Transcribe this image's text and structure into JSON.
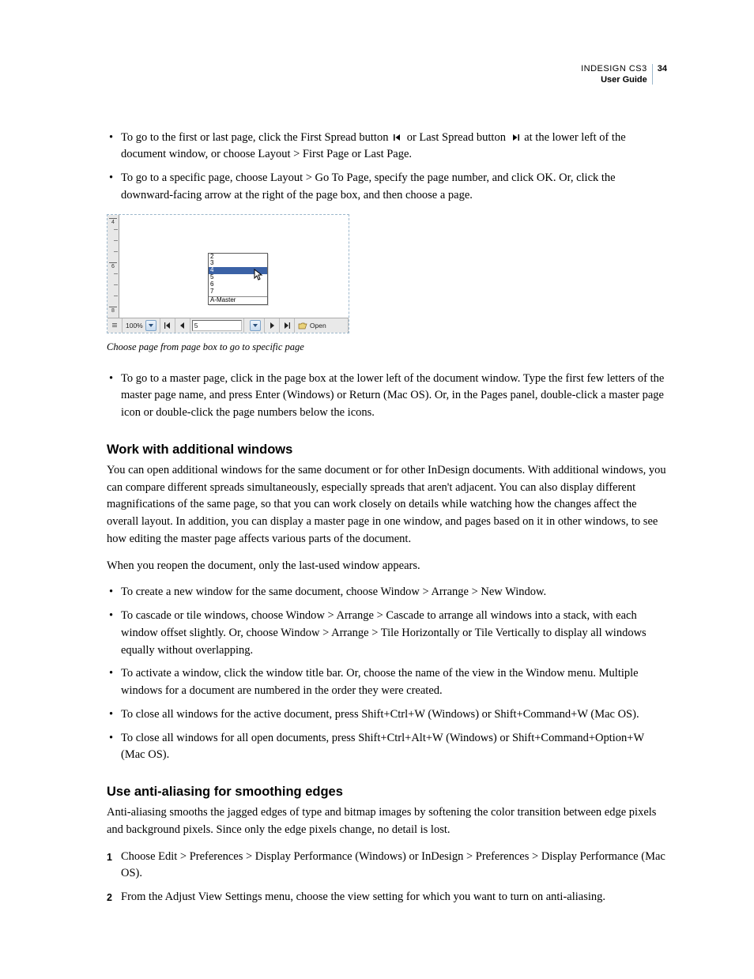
{
  "header": {
    "product": "INDESIGN CS3",
    "title": "User Guide",
    "page": "34"
  },
  "top_bullets": [
    "To go to the first or last page, click the First Spread button {ICON_FIRST} or Last Spread button {ICON_LAST} at the lower left of the document window, or choose Layout > First Page or Last Page.",
    "To go to a specific page, choose Layout > Go To Page, specify the page number, and click OK. Or, click the downward-facing arrow at the right of the page box, and then choose a page."
  ],
  "figure": {
    "ruler_labels": [
      "4",
      "6",
      "8"
    ],
    "dropdown_options": [
      "2",
      "3",
      "4",
      "5",
      "6",
      "7"
    ],
    "dropdown_selected_index": 2,
    "dropdown_master": "A-Master",
    "status": {
      "zoom": "100%",
      "pagebox_value": "5",
      "open_label": "Open"
    },
    "caption": "Choose page from page box to go to specific page"
  },
  "mid_bullets": [
    "To go to a master page, click in the page box at the lower left of the document window. Type the first few letters of the master page name, and press Enter (Windows) or Return (Mac OS). Or, in the Pages panel, double-click a master page icon or double-click the page numbers below the icons."
  ],
  "section1": {
    "heading": "Work with additional windows",
    "para1": "You can open additional windows for the same document or for other InDesign documents. With additional windows, you can compare different spreads simultaneously, especially spreads that aren't adjacent. You can also display different magnifications of the same page, so that you can work closely on details while watching how the changes affect the overall layout. In addition, you can display a master page in one window, and pages based on it in other windows, to see how editing the master page affects various parts of the document.",
    "para2": "When you reopen the document, only the last-used window appears.",
    "bullets": [
      "To create a new window for the same document, choose Window > Arrange > New Window.",
      "To cascade or tile windows, choose Window > Arrange > Cascade to arrange all windows into a stack, with each window offset slightly. Or, choose Window > Arrange > Tile Horizontally or Tile Vertically to display all windows equally without overlapping.",
      "To activate a window, click the window title bar. Or, choose the name of the view in the Window menu. Multiple windows for a document are numbered in the order they were created.",
      "To close all windows for the active document, press Shift+Ctrl+W (Windows) or Shift+Command+W (Mac OS).",
      "To close all windows for all open documents, press Shift+Ctrl+Alt+W (Windows) or Shift+Command+Option+W (Mac OS)."
    ]
  },
  "section2": {
    "heading": "Use anti-aliasing for smoothing edges",
    "para1": "Anti-aliasing smooths the jagged edges of type and bitmap images by softening the color transition between edge pixels and background pixels. Since only the edge pixels change, no detail is lost.",
    "steps": [
      "Choose Edit > Preferences > Display Performance (Windows) or InDesign > Preferences > Display Performance (Mac OS).",
      "From the Adjust View Settings menu, choose the view setting for which you want to turn on anti-aliasing."
    ]
  }
}
